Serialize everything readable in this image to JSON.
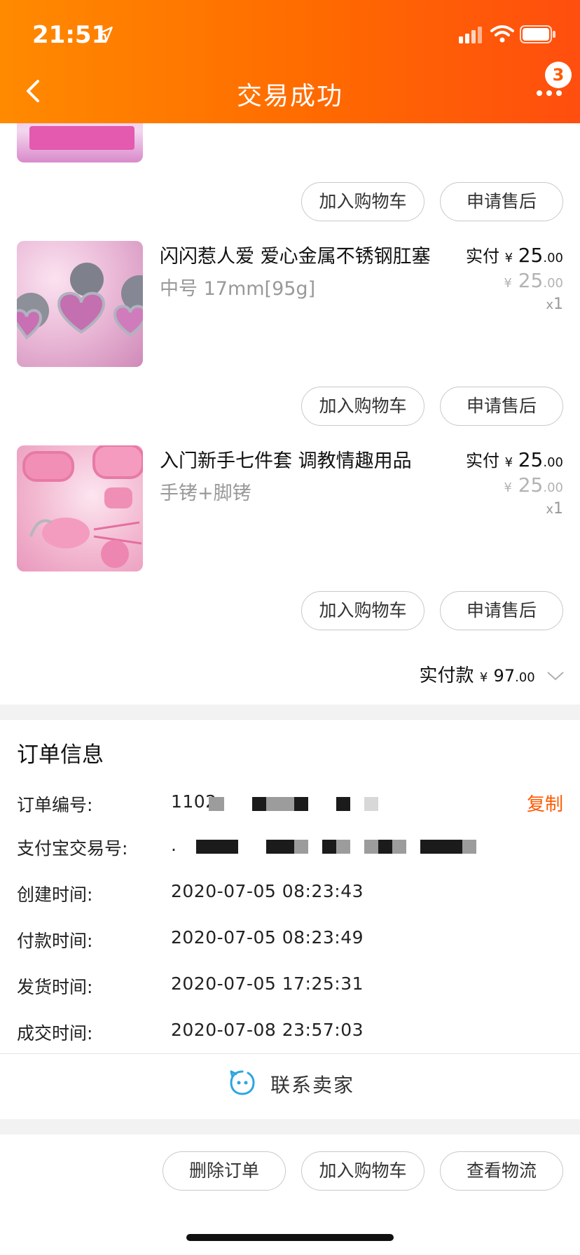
{
  "status": {
    "time": "21:51"
  },
  "nav": {
    "title": "交易成功",
    "badge": "3"
  },
  "buttons": {
    "add_to_cart": "加入购物车",
    "after_sale": "申请售后"
  },
  "products": [
    {
      "title": "闪闪惹人爱 爱心金属不锈钢肛塞",
      "spec": "中号  17mm[95g]",
      "paid_label": "实付",
      "currency": "¥",
      "paid_int": "25",
      "paid_dec": ".00",
      "orig_int": "25",
      "orig_dec": ".00",
      "qty_x": "x",
      "qty": "1"
    },
    {
      "title": "入门新手七件套 调教情趣用品",
      "spec": "手铐+脚铐",
      "paid_label": "实付",
      "currency": "¥",
      "paid_int": "25",
      "paid_dec": ".00",
      "orig_int": "25",
      "orig_dec": ".00",
      "qty_x": "x",
      "qty": "1"
    }
  ],
  "total": {
    "label": "实付款",
    "currency": "¥",
    "int": "97",
    "dec": ".00"
  },
  "order_info": {
    "title": "订单信息",
    "order_no_label": "订单编号:",
    "order_no_value": "1102",
    "copy": "复制",
    "alipay_label": "支付宝交易号:",
    "alipay_value": ".",
    "created_label": "创建时间:",
    "created_value": "2020-07-05 08:23:43",
    "paid_label": "付款时间:",
    "paid_value": "2020-07-05 08:23:49",
    "shipped_label": "发货时间:",
    "shipped_value": "2020-07-05 17:25:31",
    "done_label": "成交时间:",
    "done_value": "2020-07-08 23:57:03"
  },
  "contact": {
    "label": "联系卖家"
  },
  "bottom_bar": {
    "delete": "删除订单",
    "add_to_cart": "加入购物车",
    "logistics": "查看物流"
  },
  "colors": {
    "accent": "#ff5a00",
    "header_start": "#ff8a00",
    "header_end": "#ff4e0f"
  }
}
